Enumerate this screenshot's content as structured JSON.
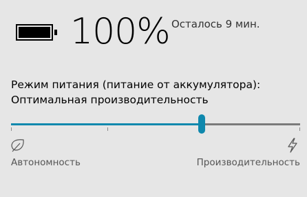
{
  "battery": {
    "icon": "battery-full-icon",
    "level_fraction": 1.0,
    "percent_text": "100%",
    "remaining_text": "Осталось 9 мин."
  },
  "power_mode": {
    "label": "Режим питания (питание от аккумулятора):",
    "value": "Оптимальная производительность",
    "slider": {
      "position_fraction": 0.66,
      "steps": 4,
      "left_label": "Автономность",
      "right_label": "Производительность",
      "left_icon": "leaf-icon",
      "right_icon": "lightning-bolt-icon"
    }
  },
  "colors": {
    "accent": "#0f88ad",
    "background": "#e6e6e6",
    "track": "#7a7a7a"
  }
}
